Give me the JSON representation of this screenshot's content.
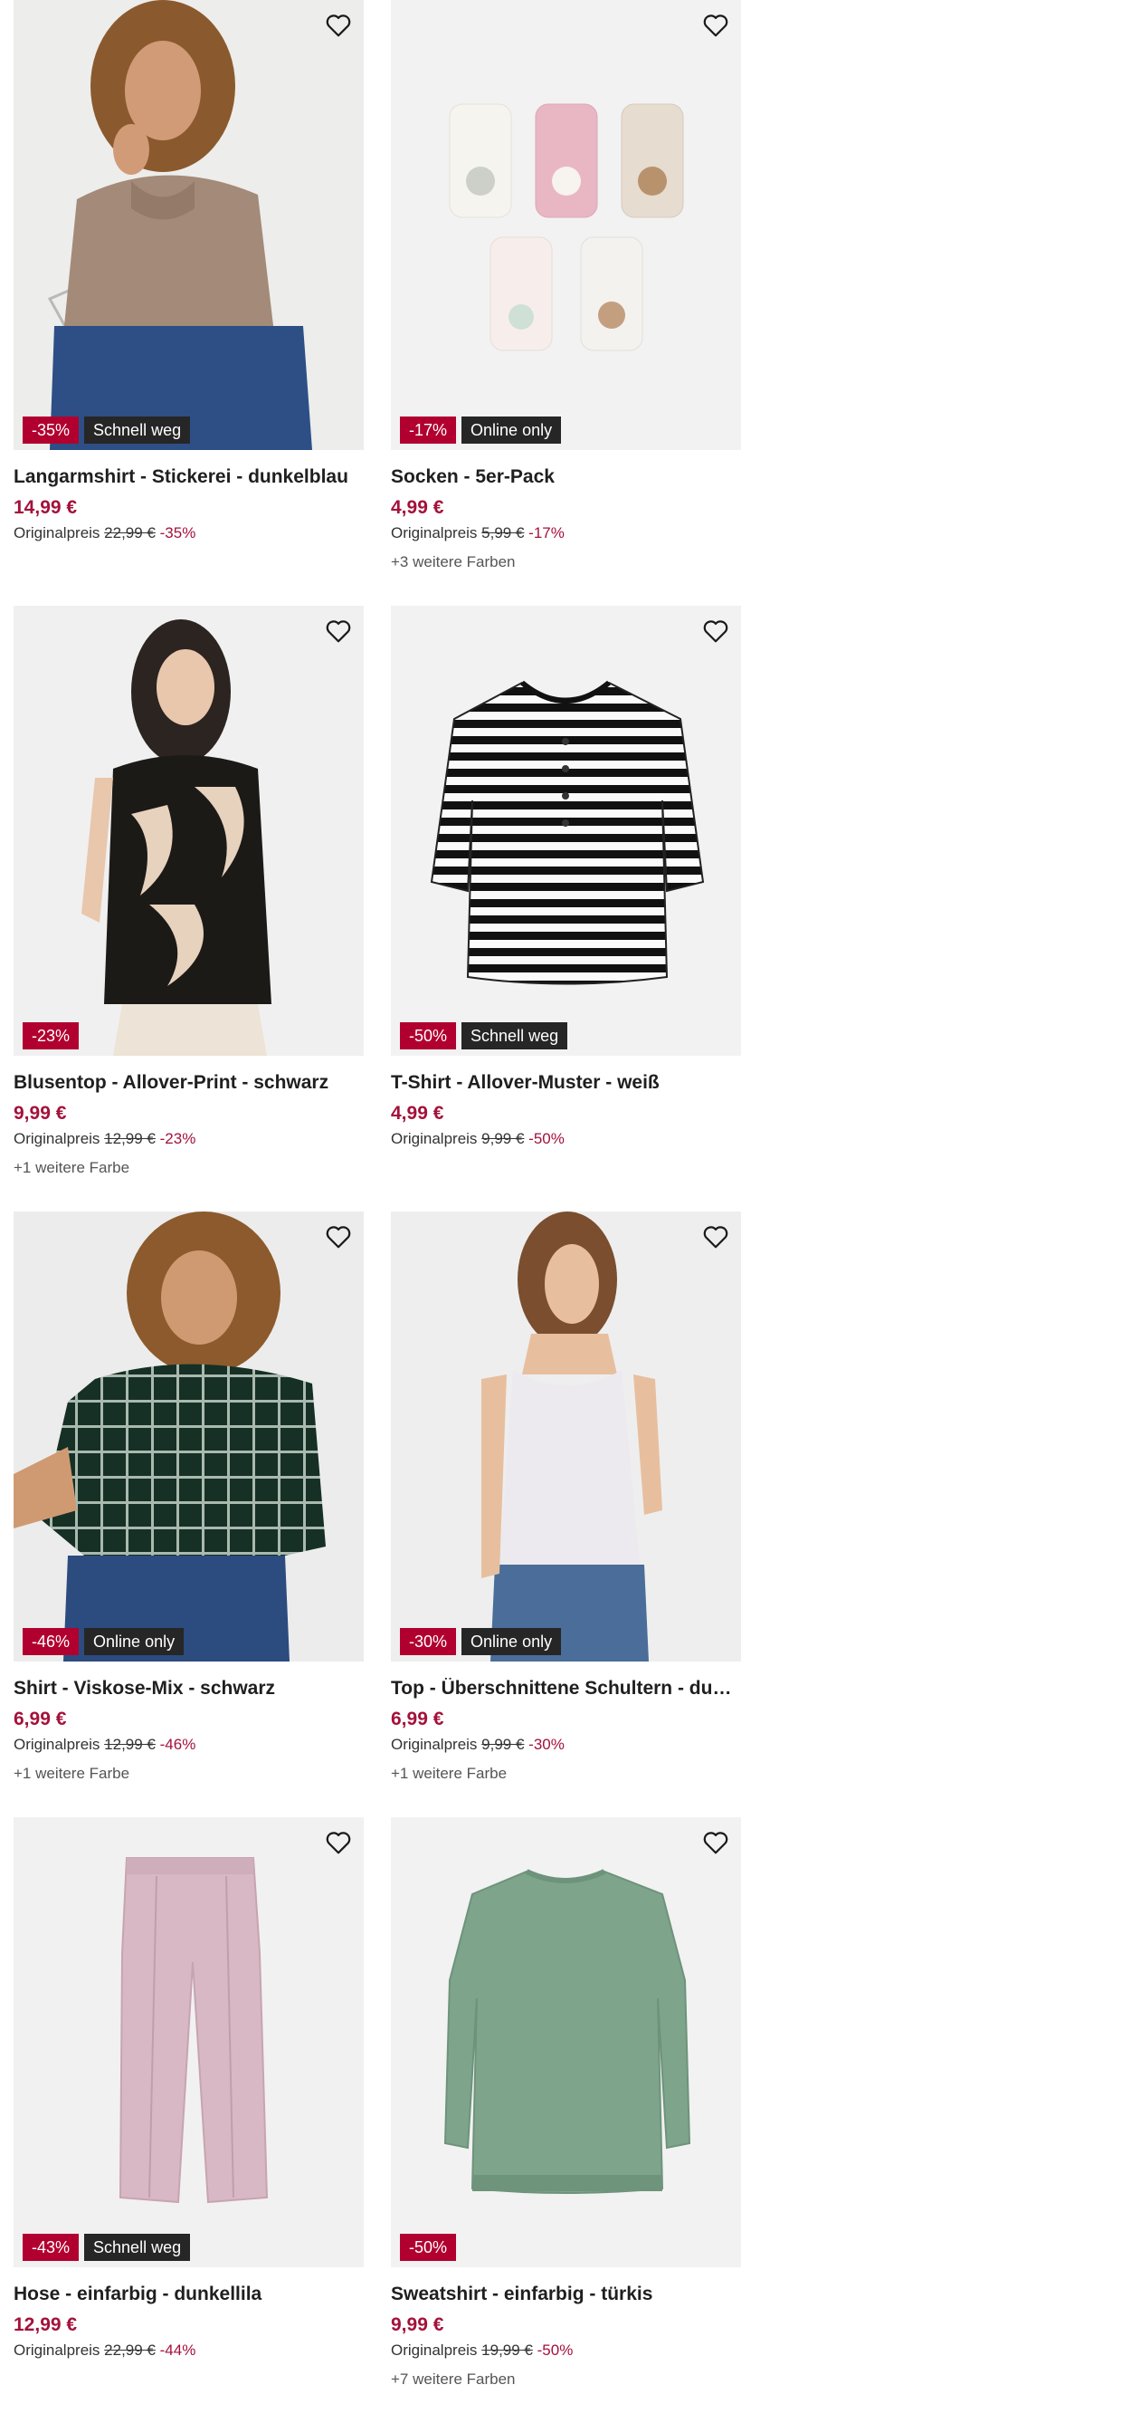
{
  "products": [
    {
      "title": "Langarmshirt - Stickerei - dunkelblau",
      "price": "14,99 €",
      "original_label": "Originalpreis",
      "original_price": "22,99 €",
      "discount_text": "-35%",
      "badge_discount": "-35%",
      "badge_tag": "Schnell weg",
      "colors_text": "",
      "image": "woman-brown-turtleneck-sweater",
      "wishlist_icon": "heart-outline-icon"
    },
    {
      "title": "Socken - 5er-Pack",
      "price": "4,99 €",
      "original_label": "Originalpreis",
      "original_price": "5,99 €",
      "discount_text": "-17%",
      "badge_discount": "-17%",
      "badge_tag": "Online only",
      "colors_text": "+3 weitere Farben",
      "image": "five-pairs-animal-socks",
      "wishlist_icon": "heart-outline-icon"
    },
    {
      "title": "Blusentop - Allover-Print - schwarz",
      "price": "9,99 €",
      "original_label": "Originalpreis",
      "original_price": "12,99 €",
      "discount_text": "-23%",
      "badge_discount": "-23%",
      "badge_tag": "",
      "colors_text": "+1 weitere Farbe",
      "image": "woman-palm-print-blouse",
      "wishlist_icon": "heart-outline-icon"
    },
    {
      "title": "T-Shirt - Allover-Muster - weiß",
      "price": "4,99 €",
      "original_label": "Originalpreis",
      "original_price": "9,99 €",
      "discount_text": "-50%",
      "badge_discount": "-50%",
      "badge_tag": "Schnell weg",
      "colors_text": "",
      "image": "striped-henley-shirt",
      "wishlist_icon": "heart-outline-icon"
    },
    {
      "title": "Shirt - Viskose-Mix - schwarz",
      "price": "6,99 €",
      "original_label": "Originalpreis",
      "original_price": "12,99 €",
      "discount_text": "-46%",
      "badge_discount": "-46%",
      "badge_tag": "Online only",
      "colors_text": "+1 weitere Farbe",
      "image": "woman-green-check-shirt",
      "wishlist_icon": "heart-outline-icon"
    },
    {
      "title": "Top - Überschnittene Schultern - dunkell...",
      "price": "6,99 €",
      "original_label": "Originalpreis",
      "original_price": "9,99 €",
      "discount_text": "-30%",
      "badge_discount": "-30%",
      "badge_tag": "Online only",
      "colors_text": "+1 weitere Farbe",
      "image": "woman-white-tank-top",
      "wishlist_icon": "heart-outline-icon"
    },
    {
      "title": "Hose - einfarbig - dunkellila",
      "price": "12,99 €",
      "original_label": "Originalpreis",
      "original_price": "22,99 €",
      "discount_text": "-44%",
      "badge_discount": "-43%",
      "badge_tag": "Schnell weg",
      "colors_text": "",
      "image": "lilac-trousers",
      "wishlist_icon": "heart-outline-icon"
    },
    {
      "title": "Sweatshirt - einfarbig - türkis",
      "price": "9,99 €",
      "original_label": "Originalpreis",
      "original_price": "19,99 €",
      "discount_text": "-50%",
      "badge_discount": "-50%",
      "badge_tag": "",
      "colors_text": "+7 weitere Farben",
      "image": "green-sweatshirt",
      "wishlist_icon": "heart-outline-icon"
    }
  ],
  "colors": {
    "price": "#a4113a",
    "discount_badge": "#b1002f",
    "tag_badge": "#262626",
    "image_bg": "#f2f2f2"
  }
}
